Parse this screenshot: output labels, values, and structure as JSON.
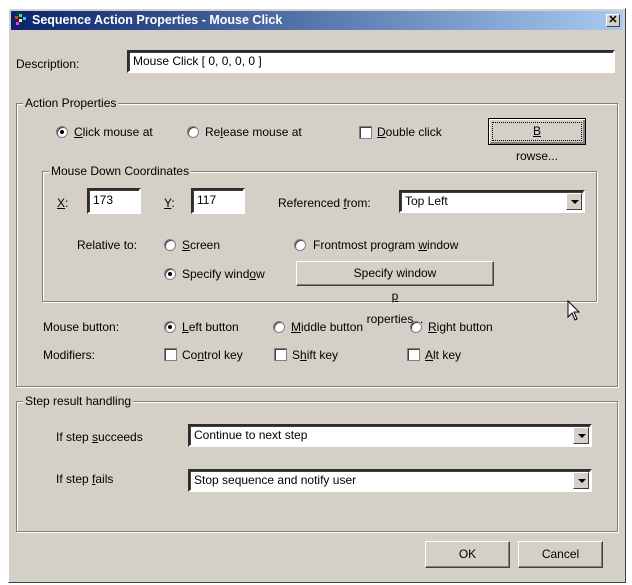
{
  "title": "Sequence Action Properties - Mouse Click",
  "close_glyph": "✕",
  "description": {
    "label": "Description:",
    "value": "Mouse Click [ 0, 0, 0, 0 ]"
  },
  "action_properties": {
    "label": "Action Properties",
    "click_mouse_at": {
      "pre": "",
      "key": "C",
      "post": "lick mouse at",
      "checked": true
    },
    "release_mouse_at": {
      "pre": "Re",
      "key": "l",
      "post": "ease mouse at",
      "checked": false
    },
    "double_click": {
      "pre": "",
      "key": "D",
      "post": "ouble click",
      "checked": false
    },
    "browse_button": {
      "pre": "",
      "key": "B",
      "post": "rowse..."
    }
  },
  "mouse_down": {
    "label": "Mouse Down Coordinates",
    "x_label_key": "X",
    "x_label_post": ":",
    "x_value": "173",
    "y_label_key": "Y",
    "y_label_post": ":",
    "y_value": "117",
    "referenced_from": {
      "pre": "Referenced ",
      "key": "f",
      "post": "rom:",
      "value": "Top Left"
    },
    "relative_to_label": "Relative to:",
    "screen": {
      "pre": "",
      "key": "S",
      "post": "creen",
      "checked": false
    },
    "frontmost": {
      "pre": "Frontmost program ",
      "key": "w",
      "post": "indow",
      "checked": false
    },
    "specify_window": {
      "pre": "Specify wind",
      "key": "o",
      "post": "w",
      "checked": true
    },
    "specify_props_button": {
      "pre": "Specify window ",
      "key": "p",
      "post": "roperties..."
    }
  },
  "mouse_button": {
    "label": "Mouse button:",
    "left": {
      "pre": "",
      "key": "L",
      "post": "eft button",
      "checked": true
    },
    "middle": {
      "pre": "",
      "key": "M",
      "post": "iddle button",
      "checked": false
    },
    "right": {
      "pre": "",
      "key": "R",
      "post": "ight button",
      "checked": false
    }
  },
  "modifiers": {
    "label": "Modifiers:",
    "control": {
      "pre": "Co",
      "key": "n",
      "post": "trol key",
      "checked": false
    },
    "shift": {
      "pre": "S",
      "key": "h",
      "post": "ift key",
      "checked": false
    },
    "alt": {
      "pre": "",
      "key": "A",
      "post": "lt key",
      "checked": false
    }
  },
  "step_result": {
    "label": "Step result handling",
    "succeeds_label": {
      "pre": "If step ",
      "key": "s",
      "post": "ucceeds"
    },
    "succeeds_value": "Continue to next step",
    "fails_label": {
      "pre": "If step ",
      "key": "f",
      "post": "ails"
    },
    "fails_value": "Stop sequence and notify user"
  },
  "ok_button": "OK",
  "cancel_button": "Cancel"
}
